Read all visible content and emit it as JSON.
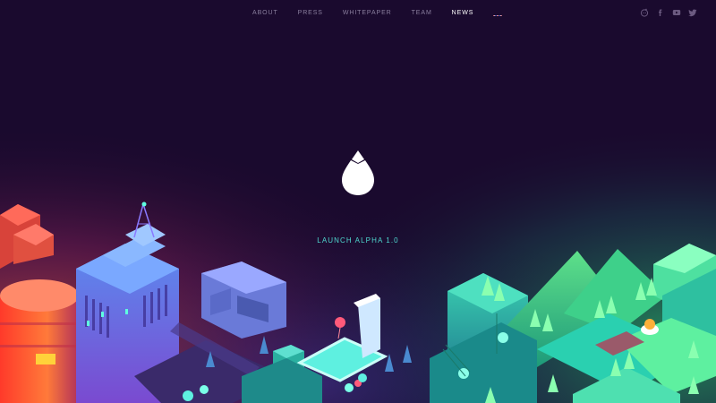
{
  "nav": {
    "links": [
      {
        "label": "ABOUT"
      },
      {
        "label": "PRESS"
      },
      {
        "label": "WHITEPAPER"
      },
      {
        "label": "TEAM"
      },
      {
        "label": "NEWS"
      }
    ],
    "active": "NEWS",
    "language_flag": "uk-flag-icon"
  },
  "social": {
    "icons": [
      "reddit-icon",
      "facebook-icon",
      "youtube-icon",
      "twitter-icon"
    ],
    "color": "#6b5a80"
  },
  "hero": {
    "logo": "droplet-logo-icon",
    "cta_label": "LAUNCH ALPHA 1.0",
    "cta_color": "#4fd8cf"
  },
  "colors": {
    "background": "#1a0a2e",
    "accent_teal": "#4fd8cf",
    "accent_orange": "#ff5a3a",
    "accent_green": "#3de08a"
  }
}
